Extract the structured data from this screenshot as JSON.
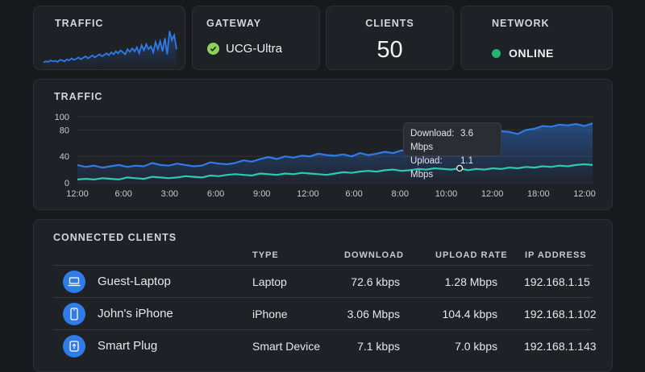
{
  "summary": {
    "traffic_label": "TRAFFIC",
    "gateway_label": "GATEWAY",
    "gateway_name": "UCG-Ultra",
    "clients_label": "CLIENTS",
    "clients_count": "50",
    "network_label": "NETWORK",
    "network_status": "ONLINE"
  },
  "chart_panel": {
    "title": "TRAFFIC",
    "tooltip": {
      "download_label": "Download:",
      "download_value": "3.6 Mbps",
      "upload_label": "Upload:",
      "upload_value": "1.1 Mbps"
    }
  },
  "chart_data": {
    "type": "area",
    "title": "TRAFFIC",
    "ylim": [
      0,
      100
    ],
    "yticks": [
      "100",
      "80",
      "40",
      "0"
    ],
    "ytick_values": [
      100,
      80,
      40,
      0
    ],
    "xtick_labels": [
      "12:00",
      "6:00",
      "3:00",
      "6:00",
      "9:00",
      "12:00",
      "6:00",
      "8:00",
      "10:00",
      "12:00",
      "18:00",
      "12:00"
    ],
    "grid": true,
    "series": [
      {
        "color": "#2f7be8",
        "values": [
          27,
          24,
          26,
          23,
          25,
          27,
          24,
          26,
          25,
          30,
          27,
          26,
          29,
          27,
          25,
          26,
          31,
          29,
          28,
          30,
          34,
          32,
          36,
          39,
          36,
          40,
          38,
          41,
          40,
          44,
          42,
          41,
          43,
          40,
          45,
          42,
          44,
          47,
          45,
          49,
          47,
          52,
          50,
          55,
          57,
          59,
          64,
          68,
          72,
          70,
          76,
          78,
          77,
          74,
          80,
          82,
          86,
          85,
          88,
          87,
          89,
          86,
          90
        ]
      },
      {
        "color": "#2fc9b1",
        "values": [
          5,
          6,
          5,
          7,
          6,
          5,
          8,
          7,
          6,
          9,
          8,
          7,
          8,
          10,
          9,
          8,
          11,
          10,
          12,
          13,
          12,
          11,
          14,
          13,
          12,
          14,
          13,
          15,
          14,
          13,
          12,
          14,
          16,
          15,
          17,
          18,
          17,
          19,
          20,
          18,
          19,
          21,
          20,
          22,
          21,
          20,
          22,
          19,
          21,
          20,
          22,
          21,
          23,
          22,
          24,
          23,
          25,
          24,
          26,
          25,
          27,
          28,
          27
        ]
      }
    ],
    "marker_index": 46
  },
  "mini_chart": {
    "color": "#2f7be8",
    "values": [
      4,
      6,
      5,
      8,
      6,
      7,
      5,
      9,
      8,
      6,
      10,
      8,
      12,
      9,
      11,
      14,
      10,
      13,
      16,
      12,
      15,
      18,
      14,
      17,
      20,
      16,
      19,
      22,
      18,
      24,
      20,
      26,
      22,
      28,
      24,
      20,
      30,
      25,
      32,
      26,
      34,
      22,
      38,
      28,
      40,
      30,
      36,
      24,
      44,
      30,
      46,
      26,
      52,
      20,
      66,
      48,
      58,
      30
    ]
  },
  "clients_panel": {
    "title": "CONNECTED CLIENTS",
    "columns": [
      "TYPE",
      "DOWNLOAD",
      "UPLOAD RATE",
      "IP ADDRESS"
    ],
    "rows": [
      {
        "icon": "laptop-icon",
        "name": "Guest-Laptop",
        "type": "Laptop",
        "download": "72.6 kbps",
        "upload": "1.28 Mbps",
        "ip": "192.168.1.15"
      },
      {
        "icon": "phone-icon",
        "name": "John's iPhone",
        "type": "iPhone",
        "download": "3.06 Mbps",
        "upload": "104.4 kbps",
        "ip": "192.168.1.102"
      },
      {
        "icon": "plug-icon",
        "name": "Smart Plug",
        "type": "Smart Device",
        "download": "7.1 kbps",
        "upload": "7.0 kbps",
        "ip": "192.168.1.143"
      }
    ]
  }
}
